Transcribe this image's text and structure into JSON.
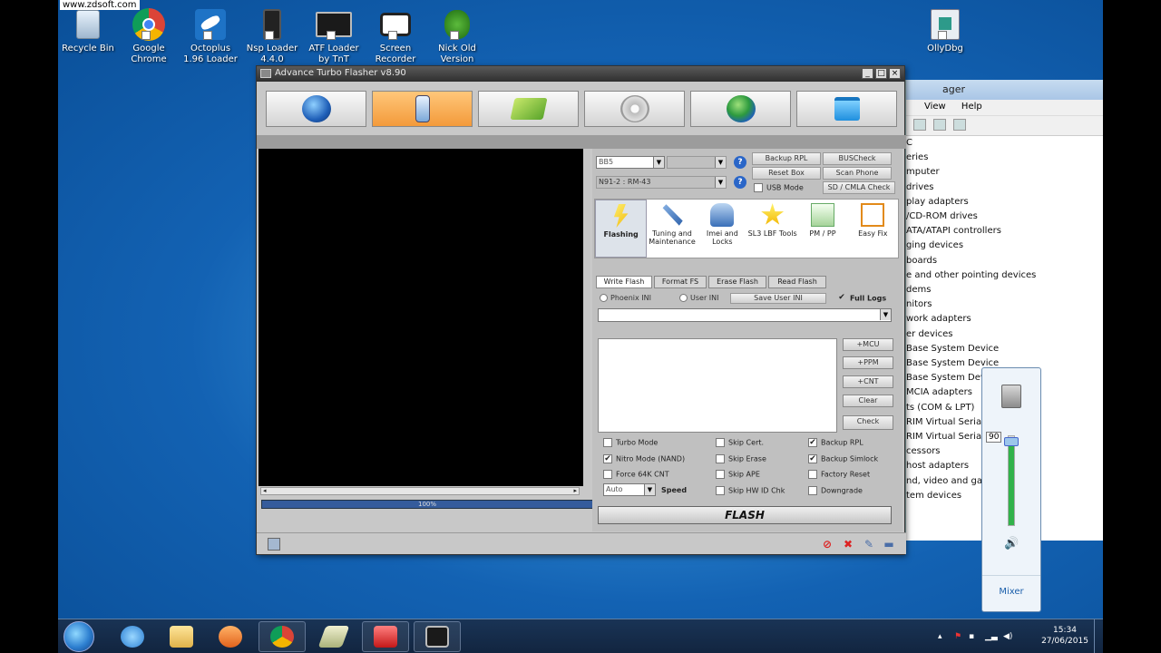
{
  "watermark": "www.zdsoft.com",
  "desktop_icons": [
    {
      "label": "Recycle Bin",
      "icon": "recycle-bin-icon"
    },
    {
      "label": "Google Chrome",
      "icon": "chrome-icon"
    },
    {
      "label": "Octoplus 1.96 Loader",
      "icon": "octoplus-icon"
    },
    {
      "label": "Nsp Loader 4.4.0",
      "icon": "nsp-loader-icon"
    },
    {
      "label": "ATF Loader by TnT",
      "icon": "atf-loader-icon"
    },
    {
      "label": "Screen Recorder",
      "icon": "screen-recorder-icon"
    },
    {
      "label": "Nick Old Version",
      "icon": "nick-old-icon"
    },
    {
      "label": "OllyDbg",
      "icon": "ollydbg-icon"
    }
  ],
  "devmgr": {
    "title": "ager",
    "menu": [
      "View",
      "Help"
    ],
    "items": [
      "C",
      "eries",
      "mputer",
      "drives",
      "play adapters",
      "/CD-ROM drives",
      "ATA/ATAPI controllers",
      "ging devices",
      "boards",
      "e and other pointing devices",
      "dems",
      "nitors",
      "work adapters",
      "er devices",
      "Base System Device",
      "Base System Device",
      "Base System Device",
      "MCIA adapters",
      "ts (COM & LPT)",
      "RIM Virtual Serial",
      "RIM Virtual Serial",
      "cessors",
      "host adapters",
      "nd, video and game",
      "tem devices"
    ]
  },
  "volume": {
    "value": "90",
    "level": 0.9,
    "mixer": "Mixer"
  },
  "app": {
    "title": "Advance Turbo Flasher  v8.90",
    "window_buttons": [
      "_",
      "□",
      "×"
    ],
    "toolbar": [
      {
        "name": "globe",
        "icon": "globe-icon"
      },
      {
        "name": "phone",
        "icon": "phone-icon"
      },
      {
        "name": "book",
        "icon": "book-icon"
      },
      {
        "name": "settings",
        "icon": "gear-icon"
      },
      {
        "name": "update",
        "icon": "download-globe-icon"
      },
      {
        "name": "shop",
        "icon": "shopping-bag-icon"
      }
    ],
    "progress": {
      "label": "100%",
      "fraction": 1.0
    },
    "select_platform": "BB5",
    "select_model": "N91-2 : RM-43",
    "buttons_top": {
      "backup_rpl": "Backup RPL",
      "buscheck": "BUSCheck",
      "reset_box": "Reset Box",
      "scan_phone": "Scan Phone",
      "usb_mode": "USB Mode",
      "sd_cmla": "SD / CMLA Check"
    },
    "modes": [
      {
        "label": "Flashing",
        "icon": "lightning-icon",
        "active": true
      },
      {
        "label": "Tuning and Maintenance",
        "icon": "tools-icon",
        "active": false
      },
      {
        "label": "Imei and Locks",
        "icon": "padlock-icon",
        "active": false
      },
      {
        "label": "SL3 LBF Tools",
        "icon": "star-icon",
        "active": false
      },
      {
        "label": "PM / PP",
        "icon": "document-icon",
        "active": false
      },
      {
        "label": "Easy Fix",
        "icon": "checkmark-icon",
        "active": false
      }
    ],
    "tabs": [
      "Write Flash",
      "Format FS",
      "Erase Flash",
      "Read Flash"
    ],
    "radios": {
      "phoenix": "Phoenix INI",
      "user": "User INI"
    },
    "save_user_ini": "Save User INI",
    "full_logs": "Full Logs",
    "side_buttons": [
      "+MCU",
      "+PPM",
      "+CNT",
      "Clear",
      "Check"
    ],
    "options_col1": [
      {
        "label": "Turbo Mode",
        "checked": false
      },
      {
        "label": "Nitro Mode (NAND)",
        "checked": true
      },
      {
        "label": "Force 64K CNT",
        "checked": false
      }
    ],
    "speed_value": "Auto",
    "speed_label": "Speed",
    "options_col2": [
      {
        "label": "Skip Cert.",
        "checked": false
      },
      {
        "label": "Skip Erase",
        "checked": false
      },
      {
        "label": "Skip APE",
        "checked": false
      },
      {
        "label": "Skip HW ID Chk",
        "checked": false
      }
    ],
    "options_col3": [
      {
        "label": "Backup RPL",
        "checked": true
      },
      {
        "label": "Backup Simlock",
        "checked": true
      },
      {
        "label": "Factory Reset",
        "checked": false
      },
      {
        "label": "Downgrade",
        "checked": false
      }
    ],
    "flash_label": "FLASH"
  },
  "taskbar": {
    "items": [
      "windows-explorer-icon",
      "internet-explorer-icon",
      "folder-icon",
      "media-player-icon",
      "chrome-icon",
      "flasher-tool-icon",
      "red-tool-icon",
      "atf-icon"
    ],
    "time": "15:34",
    "date": "27/06/2015"
  },
  "colors": {
    "accent_orange": "#f39a3a",
    "desktop_blue": "#1362b3",
    "progress_blue": "#355c9c"
  }
}
